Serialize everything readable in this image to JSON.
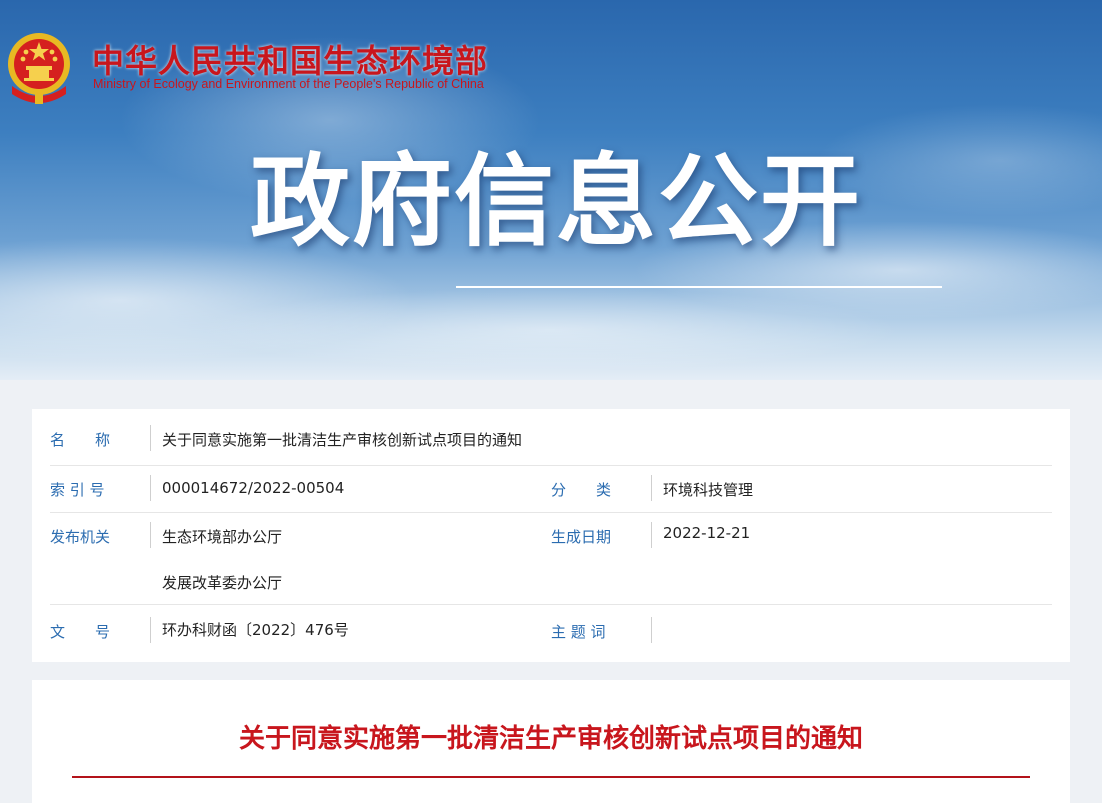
{
  "header": {
    "ministry_cn": "中华人民共和国生态环境部",
    "ministry_en": "Ministry of Ecology and Environment of the People's Republic of China",
    "emblem_icon": "national-emblem-icon",
    "hero_title": "政府信息公开"
  },
  "meta": {
    "name_label": "名　　称",
    "name_value": "关于同意实施第一批清洁生产审核创新试点项目的通知",
    "index_label": "索 引 号",
    "index_value": "000014672/2022-00504",
    "category_label": "分　　类",
    "category_value": "环境科技管理",
    "issuer_label": "发布机关",
    "issuer_values": [
      "生态环境部办公厅",
      "发展改革委办公厅"
    ],
    "date_label": "生成日期",
    "date_value": "2022-12-21",
    "docno_label": "文　　号",
    "docno_value": "环办科财函〔2022〕476号",
    "keywords_label": "主 题 词",
    "keywords_value": ""
  },
  "document": {
    "title": "关于同意实施第一批清洁生产审核创新试点项目的通知"
  },
  "colors": {
    "brand_red": "#c8161d",
    "label_blue": "#2b6cb0"
  }
}
